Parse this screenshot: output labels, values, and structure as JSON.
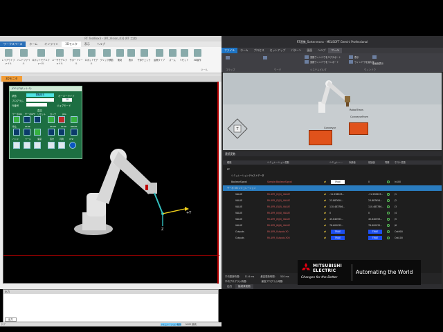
{
  "left": {
    "title": "RT ToolBox3 - [RT_Vision_03] (RT 工房)",
    "ribbon_tabs": [
      "ワークスペース",
      "ホーム",
      "オンライン",
      "3Dモニタ",
      "表示",
      "ヘルプ"
    ],
    "ribbon_active": "3Dモニタ",
    "ribbon_buttons": [
      "レイアウトファイル",
      "ハンドファイル",
      "ロボットモデルファイル",
      "ユーザモデルファイル",
      "サポートツール",
      "ロボットモデル",
      "クリック移動",
      "衝突",
      "表示",
      "干渉チェック",
      "遠隔ライブ",
      "ズーム",
      "リセット",
      "3D操作",
      "ツール"
    ],
    "viewport_tab": "3Dモニタ",
    "pendant": {
      "title": "JOG (ロボット:1)",
      "labels": [
        "状態",
        "プログラム",
        "行番号",
        "オーバーライド",
        "直交",
        "ジョグモード"
      ],
      "status_value": "運転待ち",
      "override_value": "10",
      "keys": [
        "サーボON",
        "サーボOFF",
        "リセット",
        "ロック",
        "JOG",
        "運転",
        "停止",
        "STEP",
        "START",
        "STOP",
        "RESET",
        "MODE",
        "ハンド",
        "ツール",
        "速度",
        "直交",
        "円筒",
        "XYZ",
        "ツール"
      ]
    },
    "axis_label_y": "+Y",
    "axis_label_z": "Z",
    "output_title": "出力",
    "output_tab": "出力",
    "status_left": "ﾀｲﾌﾟ",
    "status_field": "シミュレーション動作中",
    "status_right": "NUM  接続"
  },
  "right": {
    "title": "RT連携_Sorter.mcnx - MELSOFT Gemini Professional",
    "ribbon_tabs": [
      "ファイル",
      "ホーム",
      "プロセス",
      "セットアップ",
      "パターン",
      "図面",
      "ヘルプ",
      "ツール"
    ],
    "ribbon_active": "ツール",
    "ribbon_groups": [
      "コラップ",
      "ワーク",
      "システムビルダ",
      "ウィンドウ"
    ],
    "ribbon_items": [
      "変数ウィンドウをエクスポート",
      "変数ウィンドウをインポート",
      "表示",
      "ウィンドウを最大化",
      "全画面表示"
    ],
    "scene_labels": [
      "RobotTrans",
      "ConveyorFrom",
      "Conveyor"
    ],
    "vars_title": "連続変数",
    "columns": [
      "種類",
      "シミュレーション変数",
      "シミュレー...",
      "外部値",
      "前回値",
      "同期",
      "ホスト変数"
    ],
    "rows": [
      {
        "name": "RT",
        "sim": "",
        "simval": "",
        "ext": "",
        "prev": "",
        "host": "",
        "chip": "",
        "indent": 0
      },
      {
        "name": "シミュレーションテキストデータ",
        "sim": "",
        "simval": "",
        "ext": "",
        "prev": "",
        "host": "",
        "chip": "",
        "indent": 1
      },
      {
        "name": "BooleanSignal",
        "sim": "Sample.BooleanSignal",
        "simval": "TRUE",
        "ext": "",
        "prev": "0",
        "host": "In100",
        "chip": "white",
        "indent": 1
      },
      {
        "name": "サーボ ON シミュレーション",
        "sim": "",
        "simval": "",
        "ext": "",
        "prev": "",
        "host": "",
        "chip": "",
        "indent": 0,
        "selected": true
      },
      {
        "name": "VALUE",
        "sim": "RV-4FR_J1(J1)_VALUE",
        "simval": "-11.938903...",
        "ext": "",
        "prev": "-11.938903...",
        "host": "J1",
        "chip": "",
        "indent": 2
      },
      {
        "name": "VALUE",
        "sim": "RV-4FR_J2(J2)_VALUE",
        "simval": "23.887654...",
        "ext": "",
        "prev": "23.887654...",
        "host": "J2",
        "chip": "",
        "indent": 2
      },
      {
        "name": "VALUE",
        "sim": "RV-4FR_J3(J3)_VALUE",
        "simval": "110.483786...",
        "ext": "",
        "prev": "110.483786...",
        "host": "J3",
        "chip": "",
        "indent": 2
      },
      {
        "name": "VALUE",
        "sim": "RV-4FR_J4(J4)_VALUE",
        "simval": "0",
        "ext": "",
        "prev": "0",
        "host": "J4",
        "chip": "",
        "indent": 2
      },
      {
        "name": "VALUE",
        "sim": "RV-4FR_J5(J5)_VALUE",
        "simval": "45.640593...",
        "ext": "",
        "prev": "45.640593...",
        "host": "J5",
        "chip": "",
        "indent": 2
      },
      {
        "name": "VALUE",
        "sim": "RV-4FR_J6(J6)_VALUE",
        "simval": "78.600035...",
        "ext": "",
        "prev": "78.600035...",
        "host": "J6",
        "chip": "",
        "indent": 2
      },
      {
        "name": "Outputs",
        "sim": "RV-4FR_Outputs.Y0",
        "simval": "TRUE",
        "ext": "",
        "prev": "TRUE",
        "host": "Out900",
        "chip": "blue",
        "indent": 2
      },
      {
        "name": "Outputs",
        "sim": "RV-4FR_Outputs.Y00",
        "simval": "TRUE",
        "ext": "",
        "prev": "TRUE",
        "host": "Out100",
        "chip": "blue",
        "indent": 2
      }
    ],
    "summary": [
      {
        "label": "平均更新時間:",
        "value": "11.6 ms",
        "label2": "最高更新時間:",
        "value2": "520 ms"
      },
      {
        "label": "平均プログラム時間:",
        "value": "",
        "label2": "最高プログラム時間:",
        "value2": ""
      }
    ],
    "bottom_tabs": [
      "出力",
      "接続済変数"
    ]
  },
  "banner": {
    "brand_line1": "MITSUBISHI",
    "brand_line2": "ELECTRIC",
    "tagline": "Changes for the Better",
    "claim": "Automating the World"
  },
  "colors": {
    "pendant_bg": "#1d6f42",
    "robot_body": "#d9d9d9",
    "robot_accent": "#c00000",
    "box_orange": "#e0521b",
    "chip_blue": "#1d4ff0",
    "selected_row": "#2a7cbf"
  }
}
